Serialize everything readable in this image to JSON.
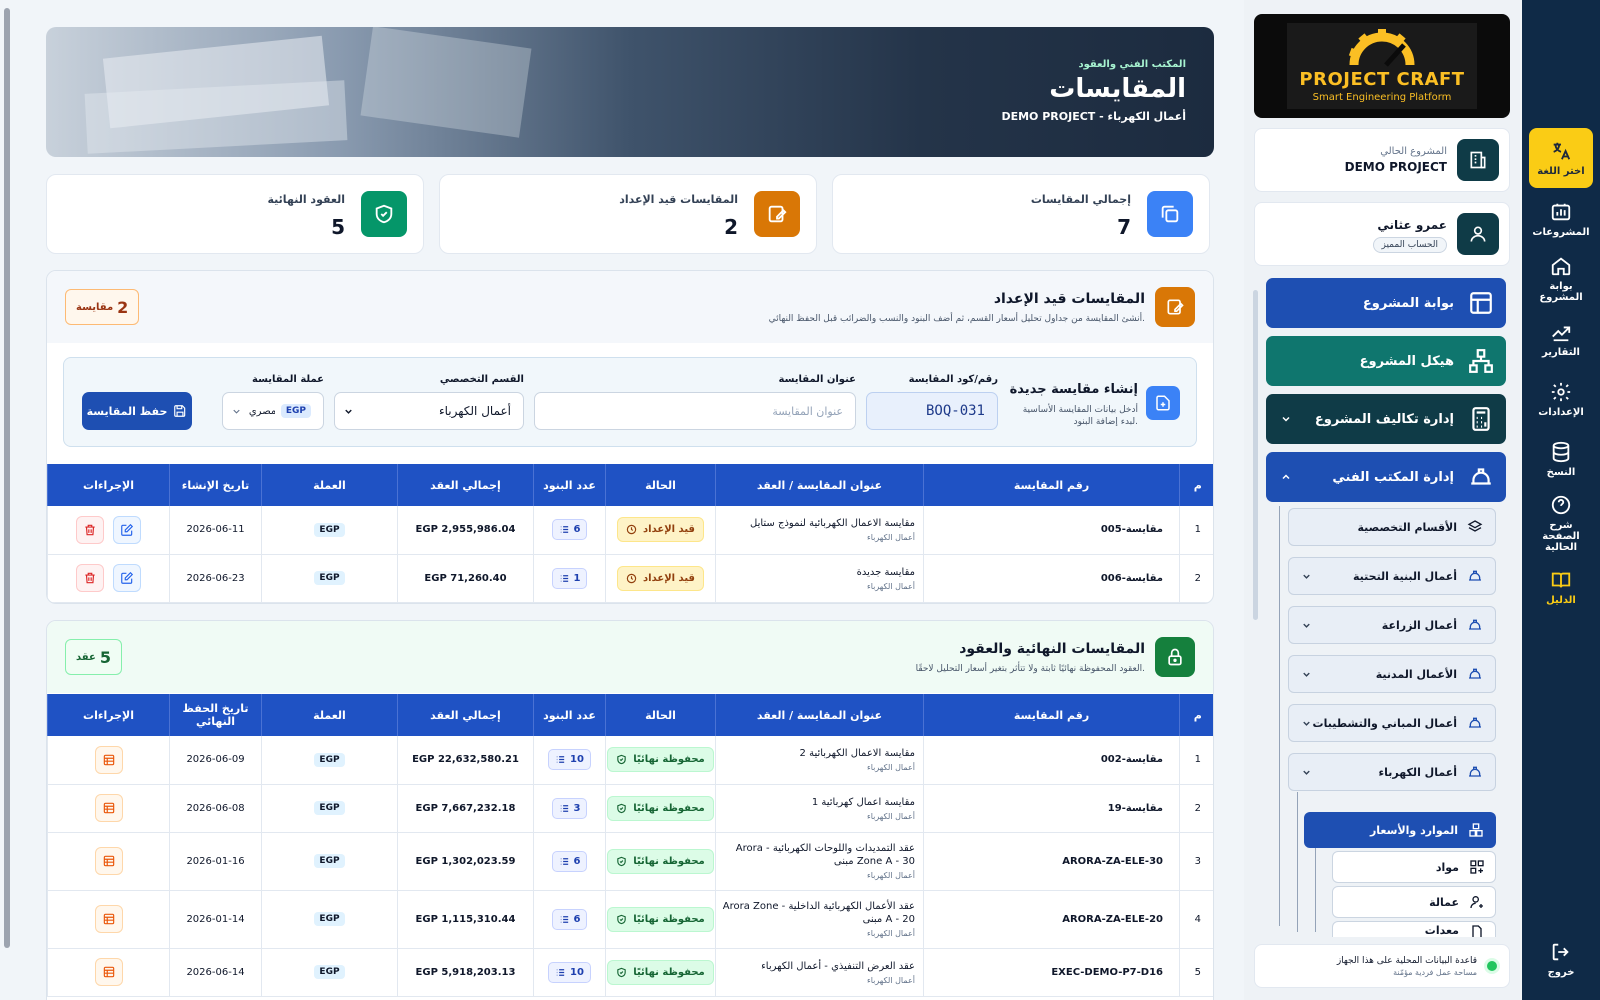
{
  "rail": {
    "items": [
      {
        "label": "اختر اللغة",
        "icon": "language-icon"
      },
      {
        "label": "المشروعات",
        "icon": "projects-icon"
      },
      {
        "label": "بوابة المشروع",
        "icon": "home-icon"
      },
      {
        "label": "التقارير",
        "icon": "chart-icon"
      },
      {
        "label": "الإعدادات",
        "icon": "gear-icon"
      },
      {
        "label": "النسخ",
        "icon": "database-icon"
      },
      {
        "label": "شرح الصفحة الحالية",
        "icon": "help-icon"
      },
      {
        "label": "الدليل",
        "icon": "book-icon"
      },
      {
        "label": "خروج",
        "icon": "logout-icon"
      }
    ]
  },
  "sidebar": {
    "logo": {
      "title": "PROJECT CRAFT",
      "subtitle": "Smart Engineering Platform"
    },
    "project_card": {
      "small": "المشروع الحالي",
      "name": "DEMO PROJECT"
    },
    "user_card": {
      "name": "عمرو عثاني",
      "badge": "الحساب المميز"
    },
    "nav": {
      "portal": "بوابة المشروع",
      "structure": "هيكل المشروع",
      "costs": "إدارة تكاليف المشروع",
      "tech_office": "إدارة المكتب الفني"
    },
    "sub": {
      "divisions": "الأقسام التخصصية",
      "infra": "أعمال البنية التحتية",
      "agri": "أعمال الزراعة",
      "civil": "الأعمال المدنية",
      "buildings": "أعمال المباني والتشطيبات",
      "electrical": "أعمال الكهرباء"
    },
    "active": "الموارد والأسعار",
    "leaves": {
      "materials": "مواد",
      "labor": "عمالة",
      "more": "معدات"
    },
    "db_status": {
      "line1": "قاعدة البيانات المحلية على هذا الجهاز",
      "line2": "مساحة عمل فردية مؤمّنة"
    },
    "colors": {
      "portal": "#1e4fb2",
      "structure": "#0f766e",
      "costs": "#0f3b47",
      "tech_office": "#1e4fb2"
    }
  },
  "hero": {
    "kicker": "المكتب الفني والعقود",
    "title": "المقايسات",
    "subtitle": "DEMO PROJECT - أعمال الكهرباء"
  },
  "stats": [
    {
      "label": "إجمالي المقايسات",
      "value": "7",
      "color": "#3b82f6",
      "icon": "copy-icon"
    },
    {
      "label": "المقايسات قيد الإعداد",
      "value": "2",
      "color": "#d97706",
      "icon": "edit-icon"
    },
    {
      "label": "العقود النهائية",
      "value": "5",
      "color": "#059669",
      "icon": "shield-icon"
    }
  ],
  "drafts": {
    "title": "المقايسات قيد الإعداد",
    "desc": "أنشئ المقايسة من جداول تحليل أسعار القسم، ثم أضف البنود والنسب والضرائب قبل الحفظ النهائي.",
    "count": "2",
    "count_unit": "مقايسة",
    "form": {
      "title": "إنشاء مقايسة جديدة",
      "hint": "أدخل بيانات المقايسة الأساسية لبدء إضافة البنود.",
      "code_label": "رقم/كود المقايسة",
      "code_value": "BOQ-031",
      "title_label": "عنوان المقايسة",
      "title_placeholder": "عنوان المقايسة",
      "division_label": "القسم التخصصي",
      "division_value": "أعمال الكهرباء",
      "currency_label": "عملة المقايسة",
      "currency_code": "EGP",
      "currency_text": "جنيه مصري",
      "save": "حفظ المقايسة"
    },
    "columns": [
      "م",
      "رقم المقايسة",
      "عنوان المقايسة / العقد",
      "الحالة",
      "عدد البنود",
      "إجمالي العقد",
      "العملة",
      "تاريخ الإنشاء",
      "الإجراءات"
    ],
    "rows": [
      {
        "n": "1",
        "code": "مقايسة-005",
        "title": "مقايسة الاعمال الكهربائية لنموذج ستايل",
        "sub": "أعمال الكهرباء",
        "status": "قيد الإعداد",
        "items": "6",
        "total": "2,955,986.04 EGP",
        "cur": "EGP",
        "date": "2026-06-11"
      },
      {
        "n": "2",
        "code": "مقايسة-006",
        "title": "مقايسة جديدة",
        "sub": "أعمال الكهرباء",
        "status": "قيد الإعداد",
        "items": "1",
        "total": "71,260.40 EGP",
        "cur": "EGP",
        "date": "2026-06-23"
      }
    ]
  },
  "finals": {
    "title": "المقايسات النهائية والعقود",
    "desc": "العقود المحفوظة نهائيًا ثابتة ولا تتأثر بتغير أسعار التحليل لاحقًا.",
    "count": "5",
    "count_unit": "عقد",
    "columns": [
      "م",
      "رقم المقايسة",
      "عنوان المقايسة / العقد",
      "الحالة",
      "عدد البنود",
      "إجمالي العقد",
      "العملة",
      "تاريخ الحفظ النهائي",
      "الإجراءات"
    ],
    "rows": [
      {
        "n": "1",
        "code": "مقايسة-002",
        "title": "مقايسة الاعمال الكهربائية 2",
        "sub": "أعمال الكهرباء",
        "status": "محفوظة نهائيًا",
        "items": "10",
        "total": "22,632,580.21 EGP",
        "cur": "EGP",
        "date": "2026-06-09"
      },
      {
        "n": "2",
        "code": "مقايسة-19",
        "title": "مقايسة اعمال كهربائية 1",
        "sub": "أعمال الكهرباء",
        "status": "محفوظة نهائيًا",
        "items": "3",
        "total": "7,667,232.18 EGP",
        "cur": "EGP",
        "date": "2026-06-08"
      },
      {
        "n": "3",
        "code": "ARORA-ZA-ELE-30",
        "title": "عقد التمديدات واللوحات الكهربائية - Arora Zone A - 30 مبنى",
        "sub": "أعمال الكهرباء",
        "status": "محفوظة نهائيًا",
        "items": "6",
        "total": "1,302,023.59 EGP",
        "cur": "EGP",
        "date": "2026-01-16"
      },
      {
        "n": "4",
        "code": "ARORA-ZA-ELE-20",
        "title": "عقد الأعمال الكهربائية الداخلية - Arora Zone A - 20 مبنى",
        "sub": "أعمال الكهرباء",
        "status": "محفوظة نهائيًا",
        "items": "6",
        "total": "1,115,310.44 EGP",
        "cur": "EGP",
        "date": "2026-01-14"
      },
      {
        "n": "5",
        "code": "EXEC-DEMO-P7-D16",
        "title": "عقد العرض التنفيذي - أعمال الكهرباء",
        "sub": "أعمال الكهرباء",
        "status": "محفوظة نهائيًا",
        "items": "10",
        "total": "5,918,203.13 EGP",
        "cur": "EGP",
        "date": "2026-06-14"
      }
    ]
  }
}
